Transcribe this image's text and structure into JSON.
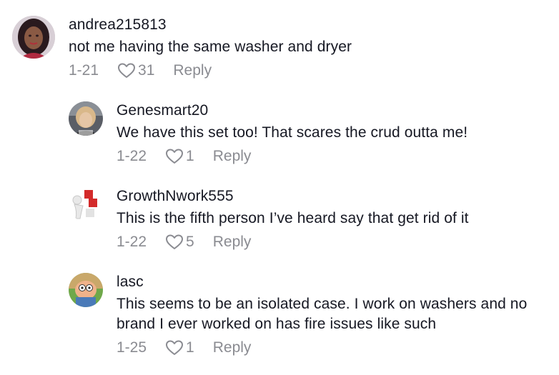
{
  "comments": [
    {
      "username": "andrea215813",
      "text": "not me having the same washer and dryer",
      "date": "1-21",
      "likes": "31",
      "reply_label": "Reply",
      "avatar_icon": "user-photo-avatar"
    },
    {
      "username": "Genesmart20",
      "text": "We have this set too! That scares the crud outta me!",
      "date": "1-22",
      "likes": "1",
      "reply_label": "Reply",
      "avatar_icon": "user-photo-avatar"
    },
    {
      "username": "GrowthNwork555",
      "text": "This is the fifth person I’ve heard say that get rid of it",
      "date": "1-22",
      "likes": "5",
      "reply_label": "Reply",
      "avatar_icon": "growth-blocks-avatar"
    },
    {
      "username": "lasc",
      "text": "This seems to be an isolated case. I work on washers and no brand I ever worked on has fire issues like such",
      "date": "1-25",
      "likes": "1",
      "reply_label": "Reply",
      "avatar_icon": "cartoon-avatar"
    }
  ],
  "colors": {
    "text": "#161823",
    "meta": "#8a8b91",
    "background": "#ffffff"
  }
}
